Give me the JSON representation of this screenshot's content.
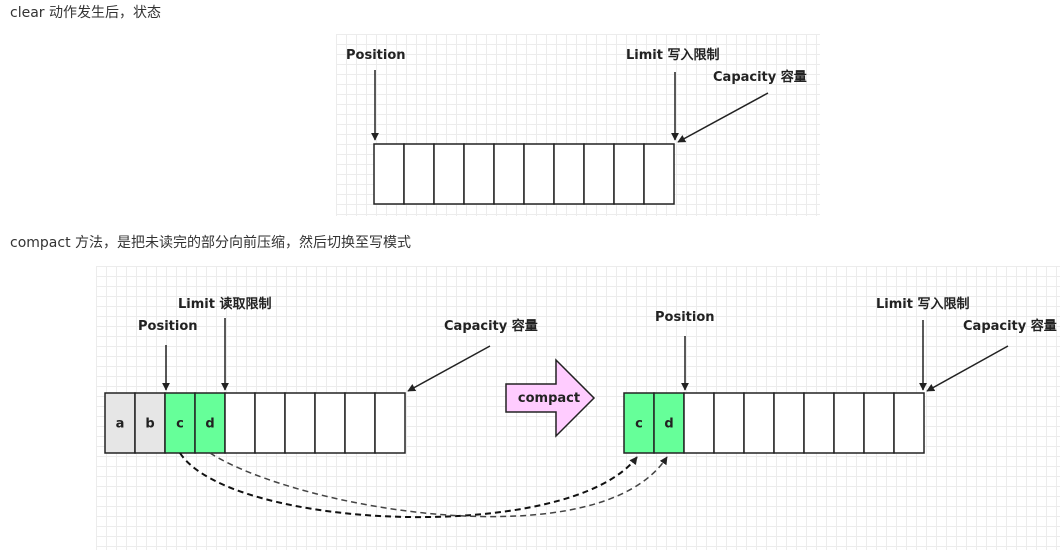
{
  "captions": {
    "clear": "clear 动作发生后，状态",
    "compact": "compact 方法，是把未读完的部分向前压缩，然后切换至写模式"
  },
  "diagram1": {
    "position_label": "Position",
    "limit_label": "Limit 写入限制",
    "capacity_label": "Capacity 容量"
  },
  "diagram2": {
    "before": {
      "limit_label": "Limit 读取限制",
      "position_label": "Position",
      "capacity_label": "Capacity 容量",
      "cells": [
        "a",
        "b",
        "c",
        "d"
      ]
    },
    "action_label": "compact",
    "after": {
      "position_label": "Position",
      "limit_label": "Limit 写入限制",
      "capacity_label": "Capacity 容量",
      "cells": [
        "c",
        "d"
      ]
    }
  },
  "colors": {
    "read_cell": "#e6e6e6",
    "unread_cell": "#66ff99",
    "compact_arrow": "#ffccff",
    "stroke": "#222222"
  }
}
